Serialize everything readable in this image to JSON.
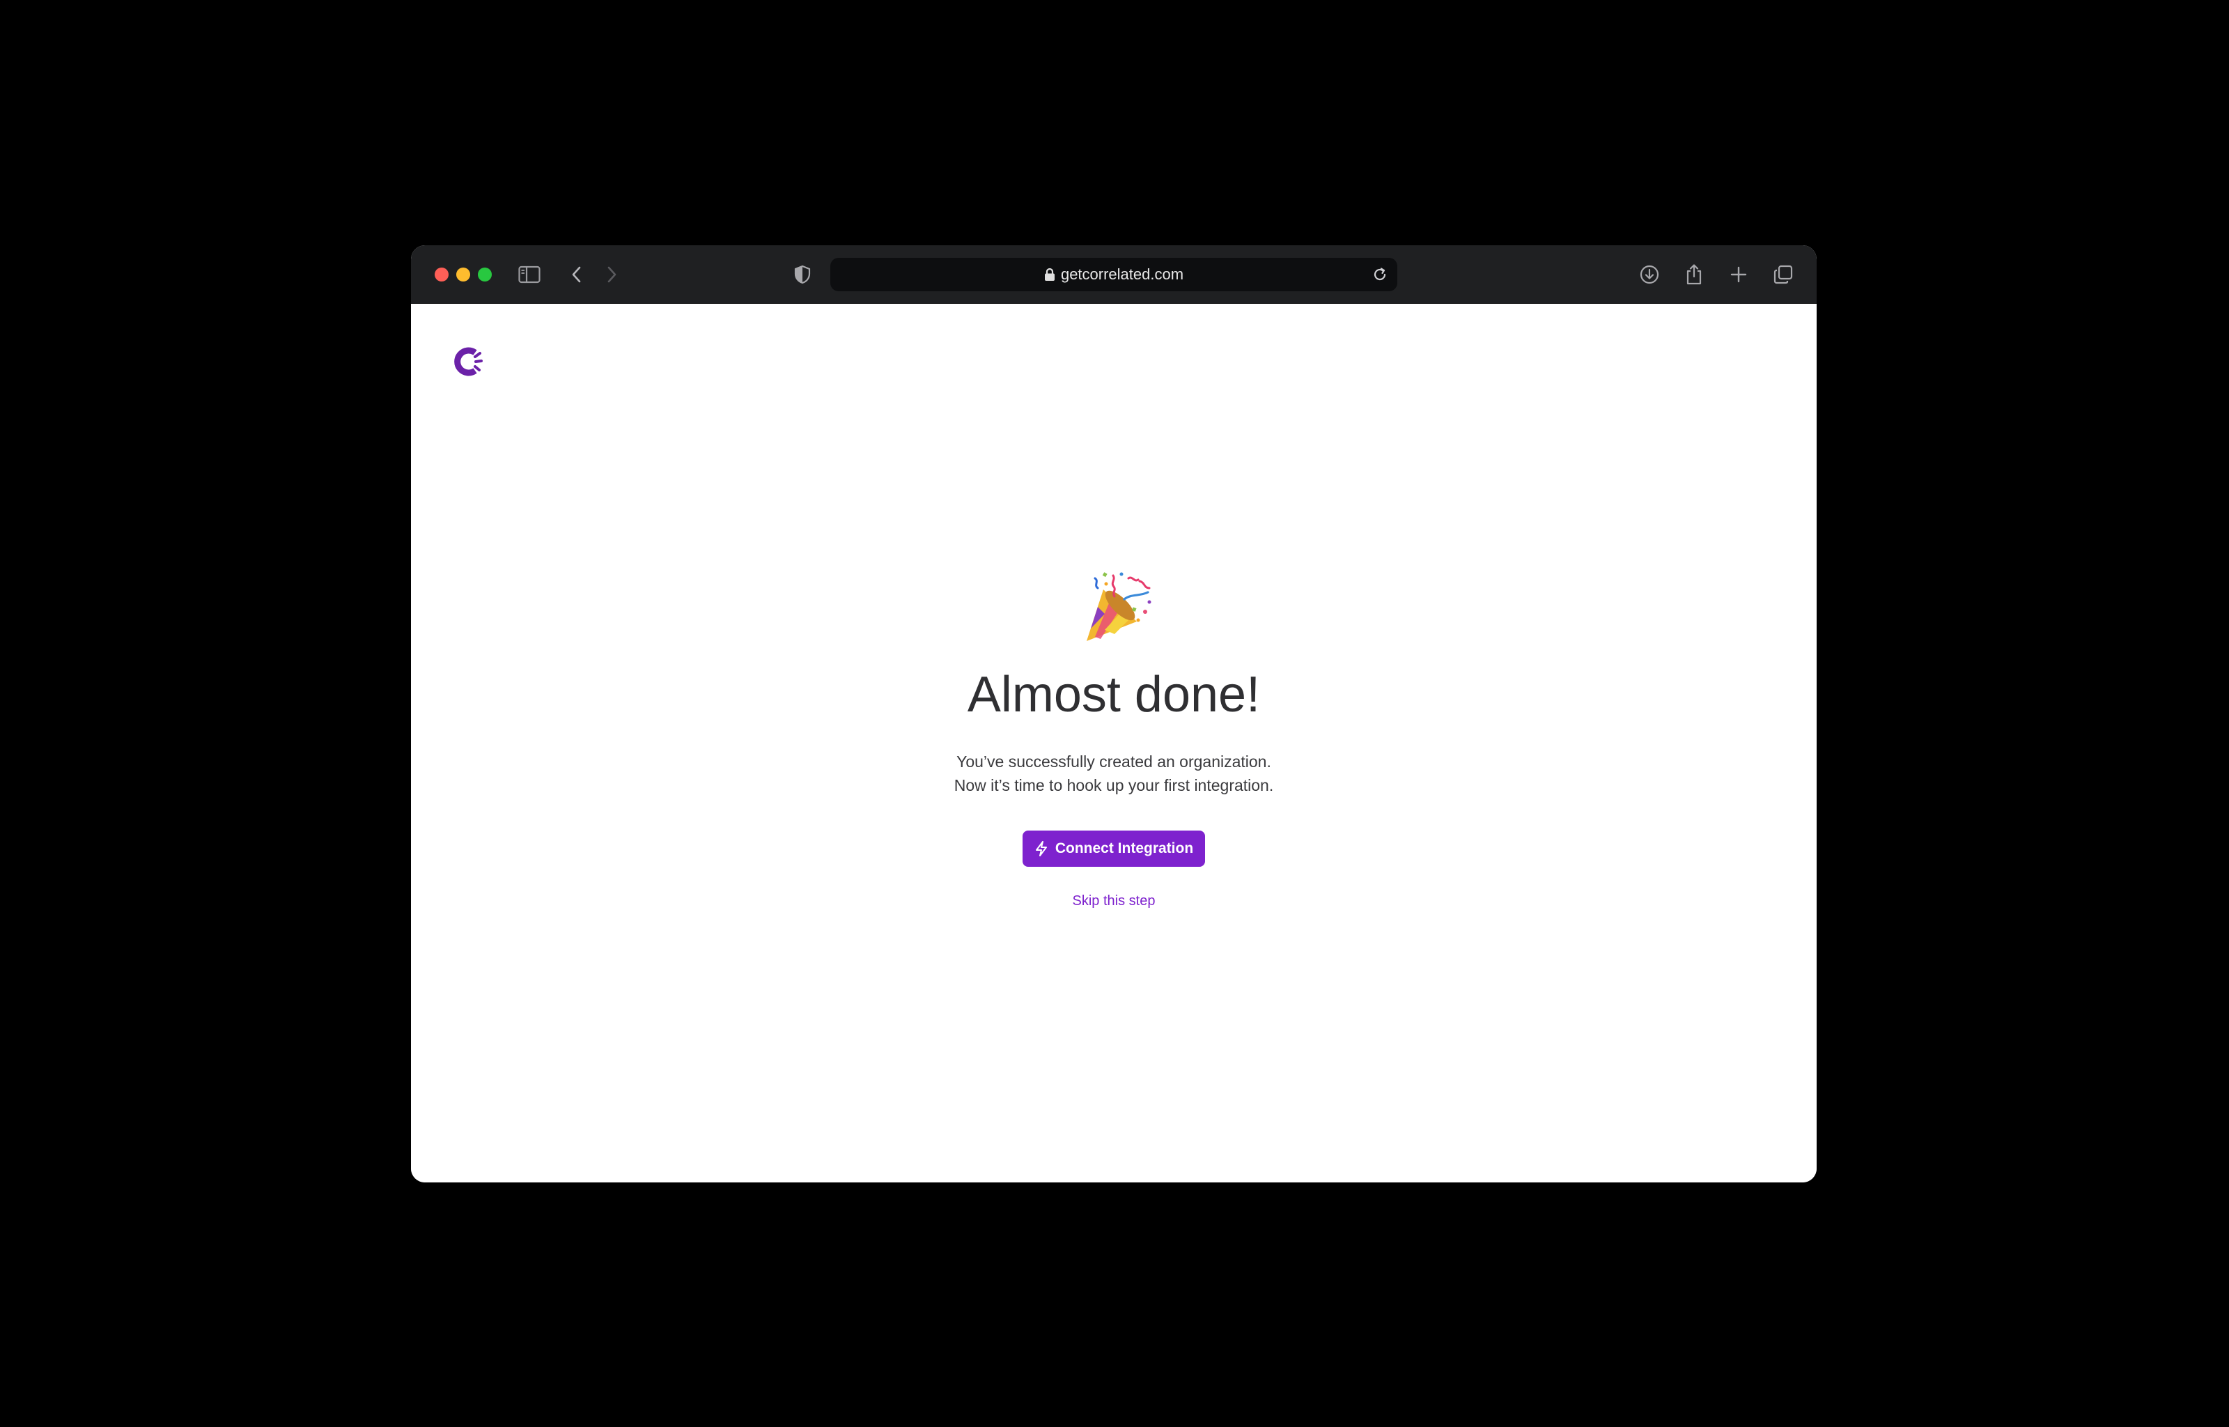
{
  "browser": {
    "url": "getcorrelated.com",
    "traffic_lights": [
      "close",
      "minimize",
      "maximize"
    ],
    "toolbar_icons": [
      "sidebar-icon",
      "back-icon",
      "forward-icon",
      "shield-icon",
      "lock-icon",
      "reload-icon",
      "download-icon",
      "share-icon",
      "new-tab-icon",
      "tabs-overview-icon"
    ]
  },
  "page": {
    "logo_icon": "correlated-logo-icon",
    "celebration_icon": "party-popper-icon",
    "title": "Almost done!",
    "subtitle_line1": "You’ve successfully created an organization.",
    "subtitle_line2": "Now it’s time to hook up your first integration.",
    "cta_label": "Connect Integration",
    "cta_icon": "lightning-bolt-icon",
    "skip_label": "Skip this step"
  },
  "colors": {
    "accent": "#7e22ce",
    "toolbar_bg": "#1f2022",
    "heading": "#2f2f32"
  }
}
